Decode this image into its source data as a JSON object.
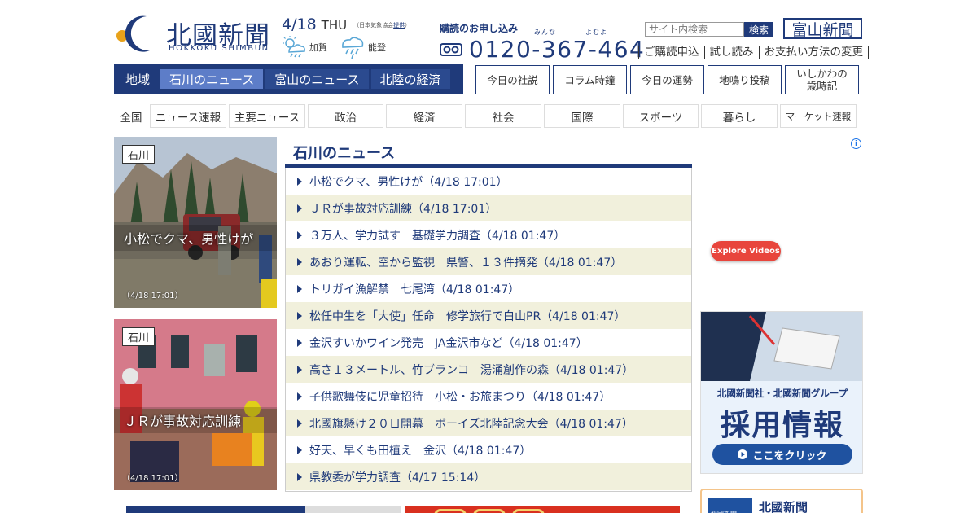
{
  "header": {
    "logo_kanji": "北國新聞",
    "logo_roman": "HOKKOKU SHIMBUN",
    "date": "4/18",
    "weekday": "THU",
    "weather_source_prefix": "（日本気象協会",
    "weather_source_link": "提供",
    "weather_source_suffix": "）",
    "weather": [
      {
        "area": "加賀",
        "icon": "sun-cloud-rain-icon"
      },
      {
        "area": "能登",
        "icon": "cloud-rain-icon"
      }
    ],
    "subscribe_label": "購読のお申し込み",
    "subscribe_ruby": "みんな　　　　よむよ",
    "phone": "0120-367-464",
    "search_placeholder": "サイト内検索",
    "search_button": "検索",
    "toyama_logo": "富山新聞",
    "util_links": [
      "ご購読申込",
      "試し読み",
      "お支払い方法の変更"
    ]
  },
  "region_nav": {
    "label": "地域",
    "tabs": [
      {
        "label": "石川のニュース",
        "active": true
      },
      {
        "label": "富山のニュース",
        "active": false
      },
      {
        "label": "北陸の経済",
        "active": false
      }
    ]
  },
  "feature_buttons": [
    "今日の社説",
    "コラム時鐘",
    "今日の運勢",
    "地鳴り投稿",
    "いしかわの\n歳時記"
  ],
  "genre_nav": [
    "全国",
    "ニュース速報",
    "主要ニュース",
    "政治",
    "経済",
    "社会",
    "国際",
    "スポーツ",
    "暮らし",
    "マーケット速報"
  ],
  "photos": [
    {
      "tag": "石川",
      "caption": "小松でクマ、男性けが",
      "time": "（4/18 17:01）"
    },
    {
      "tag": "石川",
      "caption": "ＪＲが事故対応訓練",
      "time": "（4/18 17:01）"
    }
  ],
  "news": {
    "title": "石川のニュース",
    "items": [
      "小松でクマ、男性けが（4/18 17:01）",
      "ＪＲが事故対応訓練（4/18 17:01）",
      "３万人、学力試す　基礎学力調査（4/18 01:47）",
      "あおり運転、空から監視　県警、１３件摘発（4/18 01:47）",
      "トリガイ漁解禁　七尾湾（4/18 01:47）",
      "松任中生を「大使」任命　修学旅行で白山PR（4/18 01:47）",
      "金沢すいかワイン発売　JA金沢市など（4/18 01:47）",
      "高さ１３メートル、竹ブランコ　湯涌創作の森（4/18 01:47）",
      "子供歌舞伎に児童招待　小松・お旅まつり（4/18 01:47）",
      "北國旗懸け２０日開幕　ボーイズ北陸記念大会（4/18 01:47）",
      "好天、早くも田植え　金沢（4/18 01:47）",
      "県教委が学力調査（4/17 15:14）"
    ]
  },
  "sidebar": {
    "ad_info": "i",
    "explore_label": "Explore Videos",
    "recruit_sub": "北國新聞社・北國新聞グループ",
    "recruit_title": "採用情報",
    "recruit_button": "ここをクリック",
    "bottom_logo": "北國新聞",
    "bottom_title": "北國新聞"
  },
  "colors": {
    "brand": "#1f3a7a",
    "active_tab": "#5d7dc8",
    "row_alt": "#f1f0dc"
  }
}
